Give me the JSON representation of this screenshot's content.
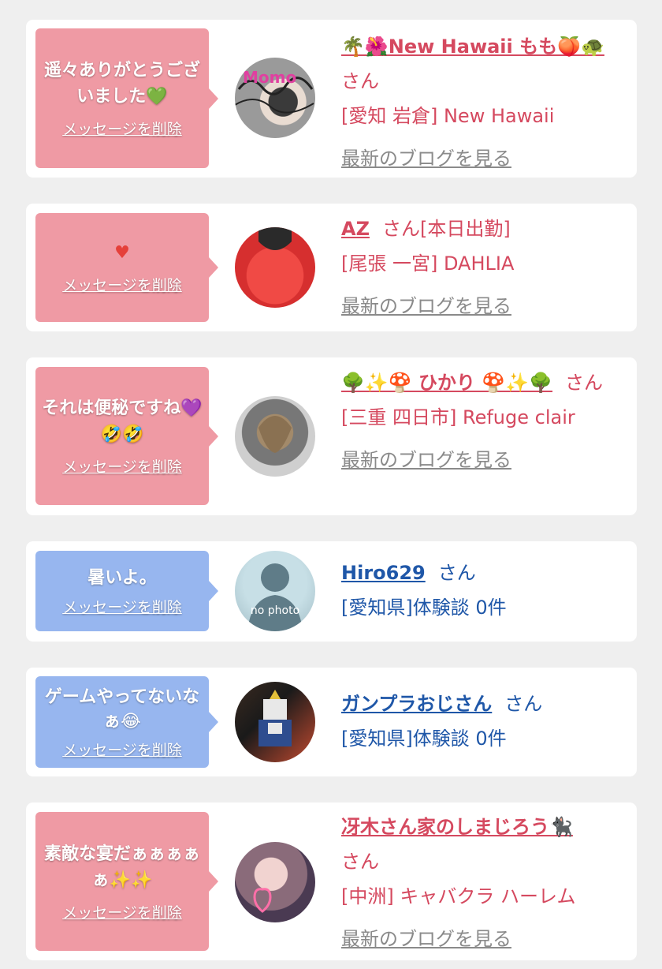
{
  "colors": {
    "pink_bubble": "#ef9aa4",
    "blue_bubble": "#97b6ef",
    "pink_text": "#d5495f",
    "blue_text": "#1f57a8",
    "blog_link": "#8a8a8a"
  },
  "messages": [
    {
      "message": "遥々ありがとうございました💚",
      "delete_label": "メッセージを削除",
      "name": "🌴🌺New Hawaii もも🍑🐢",
      "suffix": "さん",
      "location": "[愛知 岩倉] New Hawaii",
      "blog_link": "最新のブログを見る",
      "theme": "pink"
    },
    {
      "message": "♥",
      "delete_label": "メッセージを削除",
      "name": "AZ",
      "suffix": "さん[本日出勤]",
      "location": "[尾張 一宮] DAHLIA",
      "blog_link": "最新のブログを見る",
      "theme": "pink"
    },
    {
      "message": "それは便秘ですね💜🤣🤣",
      "delete_label": "メッセージを削除",
      "name": "🌳✨🍄 ひかり 🍄✨🌳",
      "suffix": "さん",
      "location": "[三重 四日市] Refuge clair",
      "blog_link": "最新のブログを見る",
      "theme": "pink"
    },
    {
      "message": "暑いよ。",
      "delete_label": "メッセージを削除",
      "name": "Hiro629",
      "suffix": "さん",
      "location": "[愛知県]体験談 0件",
      "avatar_text": "no photo",
      "theme": "blue"
    },
    {
      "message": "ゲームやってないなぁ😂",
      "delete_label": "メッセージを削除",
      "name": "ガンプラおじさん",
      "suffix": "さん",
      "location": "[愛知県]体験談 0件",
      "theme": "blue"
    },
    {
      "message": "素敵な宴だぁぁぁぁぁ✨✨",
      "delete_label": "メッセージを削除",
      "name": "冴木さん家のしまじろう🐈‍⬛",
      "suffix": "さん",
      "location": "[中洲] キャバクラ ハーレム",
      "blog_link": "最新のブログを見る",
      "theme": "pink"
    }
  ]
}
